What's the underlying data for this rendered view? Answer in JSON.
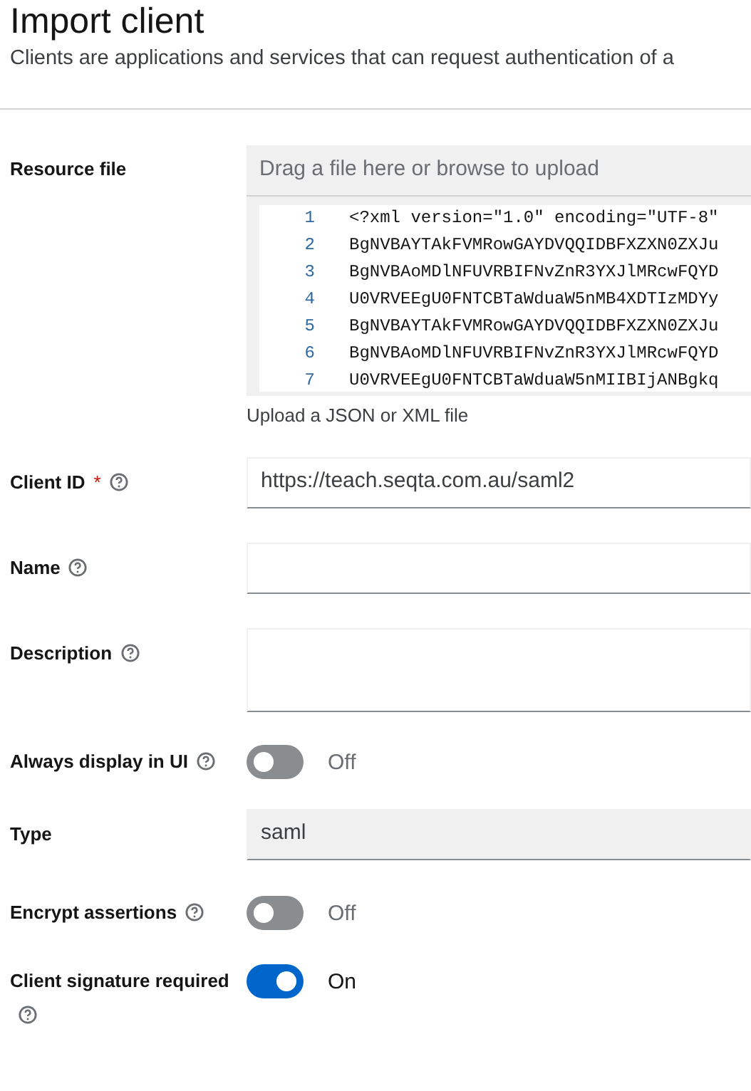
{
  "header": {
    "title": "Import client",
    "description": "Clients are applications and services that can request authentication of a"
  },
  "fields": [
    {
      "kind": "upload",
      "label": "Resource file",
      "placeholder": "Drag a file here or browse to upload",
      "helper": "Upload a JSON or XML file",
      "code_lines": [
        {
          "number": "1",
          "text": "<?xml version=\"1.0\" encoding=\"UTF-8\""
        },
        {
          "number": "2",
          "text": "BgNVBAYTAkFVMRowGAYDVQQIDBFXZXN0ZXJu"
        },
        {
          "number": "3",
          "text": "BgNVBAoMDlNFUVRBIFNvZnR3YXJlMRcwFQYD"
        },
        {
          "number": "4",
          "text": "U0VRVEEgU0FNTCBTaWduaW5nMB4XDTIzMDYy"
        },
        {
          "number": "5",
          "text": "BgNVBAYTAkFVMRowGAYDVQQIDBFXZXN0ZXJu"
        },
        {
          "number": "6",
          "text": "BgNVBAoMDlNFUVRBIFNvZnR3YXJlMRcwFQYD"
        },
        {
          "number": "7",
          "text": "U0VRVEEgU0FNTCBTaWduaW5nMIIBIjANBgkq"
        }
      ]
    },
    {
      "kind": "text",
      "label": "Client ID",
      "required_mark": "*",
      "help": true,
      "value": "https://teach.seqta.com.au/saml2"
    },
    {
      "kind": "text",
      "label": "Name",
      "help": true
    },
    {
      "kind": "textarea",
      "label": "Description",
      "help": true
    },
    {
      "kind": "toggle",
      "label": "Always display in UI",
      "help": true,
      "on": false,
      "state_text": "Off"
    },
    {
      "kind": "readonly",
      "label": "Type",
      "value": "saml"
    },
    {
      "kind": "toggle",
      "label": "Encrypt assertions",
      "help": true,
      "on": false,
      "state_text": "Off"
    },
    {
      "kind": "toggle",
      "label": "Client signature required",
      "help": true,
      "on": true,
      "state_text": "On"
    }
  ]
}
